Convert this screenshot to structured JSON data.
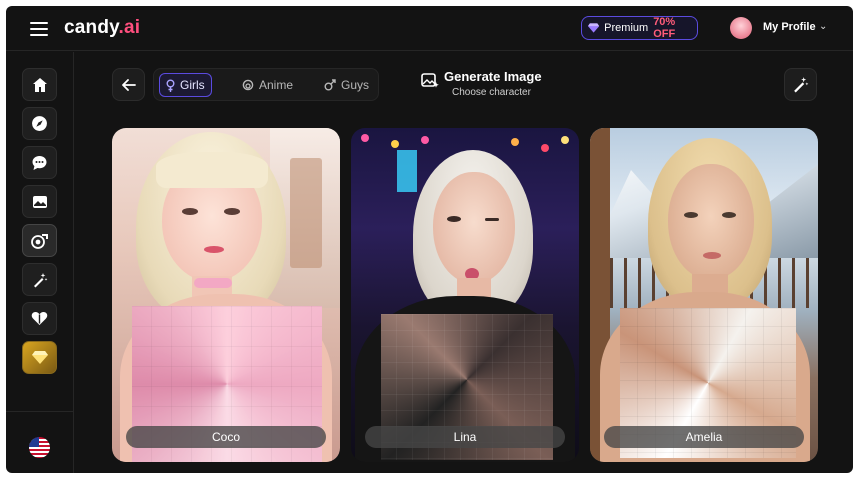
{
  "app": {
    "logo_main": "candy",
    "logo_suffix": ".ai"
  },
  "topbar": {
    "premium_label": "Premium",
    "premium_discount": "70% OFF",
    "profile_label": "My Profile"
  },
  "sidebar": {
    "items": [
      {
        "icon": "home-icon"
      },
      {
        "icon": "compass-icon"
      },
      {
        "icon": "chat-icon"
      },
      {
        "icon": "gallery-icon"
      },
      {
        "icon": "character-icon",
        "active": true
      },
      {
        "icon": "magic-wand-icon"
      },
      {
        "icon": "heart-icon"
      },
      {
        "icon": "diamond-icon",
        "highlight": "gold"
      }
    ],
    "language_icon": "us-flag-icon"
  },
  "filter_tabs": [
    {
      "label": "Girls",
      "icon": "female-icon",
      "active": true
    },
    {
      "label": "Anime",
      "icon": "anime-icon",
      "active": false
    },
    {
      "label": "Guys",
      "icon": "male-icon",
      "active": false
    }
  ],
  "generate": {
    "title": "Generate Image",
    "subtitle": "Choose character"
  },
  "characters": [
    {
      "name": "Coco"
    },
    {
      "name": "Lina"
    },
    {
      "name": "Amelia"
    }
  ],
  "colors": {
    "accent": "#5b4be0",
    "brand_pink": "#ff4f7e",
    "background": "#131313"
  }
}
